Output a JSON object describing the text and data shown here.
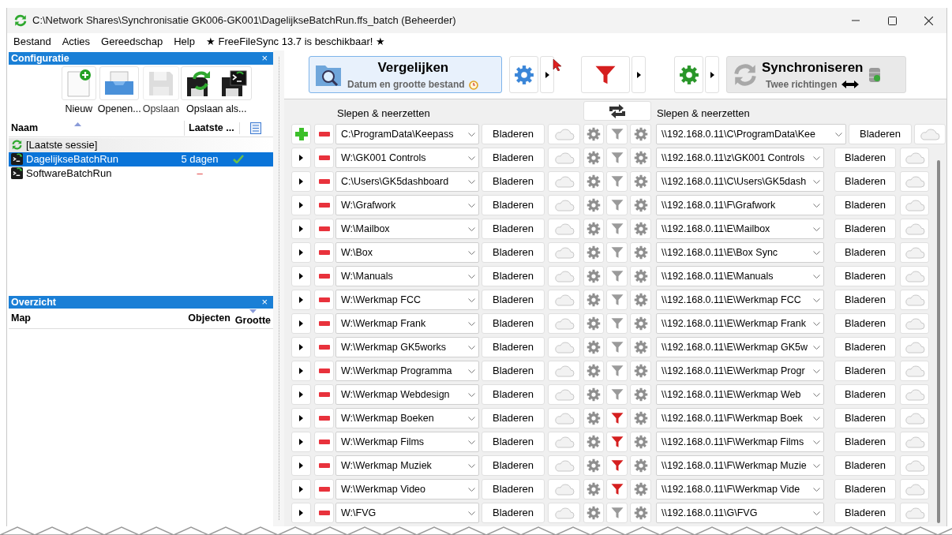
{
  "window": {
    "title": "C:\\Network Shares\\Synchronisatie GK006-GK001\\DagelijkseBatchRun.ffs_batch (Beheerder)"
  },
  "menu": [
    "Bestand",
    "Acties",
    "Gereedschap",
    "Help"
  ],
  "update_notice": "★ FreeFileSync 13.7 is beschikbaar! ★",
  "config_panel": {
    "title": "Configuratie",
    "close": "×",
    "tools": [
      {
        "kind": "new",
        "label": "Nieuw",
        "disabled": false
      },
      {
        "kind": "open",
        "label": "Openen...",
        "disabled": false
      },
      {
        "kind": "save",
        "label": "Opslaan",
        "disabled": true
      },
      {
        "kind": "save_as",
        "label": "Opslaan als...",
        "disabled": false
      }
    ],
    "columns": [
      "Naam",
      "Laatste ..."
    ],
    "items": [
      {
        "kind": "session",
        "name": "[Laatste sessie]",
        "selected": false
      },
      {
        "kind": "batch",
        "name": "DagelijkseBatchRun",
        "last_sync": "5 dagen",
        "ok": true,
        "selected": true
      },
      {
        "kind": "batch",
        "name": "SoftwareBatchRun",
        "last_sync": "–",
        "ok": false,
        "selected": false
      }
    ]
  },
  "overview_panel": {
    "title": "Overzicht",
    "close": "×",
    "columns": [
      "Map",
      "Objecten",
      "Grootte"
    ]
  },
  "compare_button": {
    "title": "Vergelijken",
    "subtitle": "Datum en grootte bestand"
  },
  "sync_button": {
    "title": "Synchroniseren",
    "subtitle": "Twee richtingen"
  },
  "folder_header": {
    "left": "Slepen & neerzetten",
    "right": "Slepen & neerzetten"
  },
  "folder_pairs": [
    {
      "kind": "base",
      "left": "C:\\ProgramData\\Keepass",
      "right": "\\\\192.168.0.11\\C\\ProgramData\\Kee",
      "browse_left": "Bladeren",
      "browse_right": "Bladeren",
      "filter_active": false
    },
    {
      "kind": "pair",
      "expanded": false,
      "left": "W:\\GK001 Controls",
      "right": "\\\\192.168.0.11\\z\\GK001 Controls",
      "browse_left": "Bladeren",
      "browse_right": "Bladeren",
      "filter_active": false
    },
    {
      "kind": "pair",
      "expanded": false,
      "left": "C:\\Users\\GK5dashboard",
      "right": "\\\\192.168.0.11\\C\\Users\\GK5dash",
      "browse_left": "Bladeren",
      "browse_right": "Bladeren",
      "filter_active": false
    },
    {
      "kind": "pair",
      "expanded": false,
      "left": "W:\\Grafwork",
      "right": "\\\\192.168.0.11\\F\\Grafwork",
      "browse_left": "Bladeren",
      "browse_right": "Bladeren",
      "filter_active": false
    },
    {
      "kind": "pair",
      "expanded": false,
      "left": "W:\\Mailbox",
      "right": "\\\\192.168.0.11\\E\\Mailbox",
      "browse_left": "Bladeren",
      "browse_right": "Bladeren",
      "filter_active": false
    },
    {
      "kind": "pair",
      "expanded": false,
      "left": "W:\\Box",
      "right": "\\\\192.168.0.11\\E\\Box Sync",
      "browse_left": "Bladeren",
      "browse_right": "Bladeren",
      "filter_active": false
    },
    {
      "kind": "pair",
      "expanded": false,
      "left": "W:\\Manuals",
      "right": "\\\\192.168.0.11\\E\\Manuals",
      "browse_left": "Bladeren",
      "browse_right": "Bladeren",
      "filter_active": false
    },
    {
      "kind": "pair",
      "expanded": false,
      "left": "W:\\Werkmap FCC",
      "right": "\\\\192.168.0.11\\E\\Werkmap FCC",
      "browse_left": "Bladeren",
      "browse_right": "Bladeren",
      "filter_active": false
    },
    {
      "kind": "pair",
      "expanded": false,
      "left": "W:\\Werkmap Frank",
      "right": "\\\\192.168.0.11\\E\\Werkmap Frank",
      "browse_left": "Bladeren",
      "browse_right": "Bladeren",
      "filter_active": false
    },
    {
      "kind": "pair",
      "expanded": false,
      "left": "W:\\Werkmap GK5works",
      "right": "\\\\192.168.0.11\\E\\Werkmap GK5w",
      "browse_left": "Bladeren",
      "browse_right": "Bladeren",
      "filter_active": false
    },
    {
      "kind": "pair",
      "expanded": false,
      "left": "W:\\Werkmap Programma",
      "right": "\\\\192.168.0.11\\E\\Werkmap Progr",
      "browse_left": "Bladeren",
      "browse_right": "Bladeren",
      "filter_active": false
    },
    {
      "kind": "pair",
      "expanded": false,
      "left": "W:\\Werkmap Webdesign",
      "right": "\\\\192.168.0.11\\E\\Werkmap Web",
      "browse_left": "Bladeren",
      "browse_right": "Bladeren",
      "filter_active": false
    },
    {
      "kind": "pair",
      "expanded": false,
      "left": "W:\\Werkmap Boeken",
      "right": "\\\\192.168.0.11\\F\\Werkmap Boek",
      "browse_left": "Bladeren",
      "browse_right": "Bladeren",
      "filter_active": true
    },
    {
      "kind": "pair",
      "expanded": false,
      "left": "W:\\Werkmap Films",
      "right": "\\\\192.168.0.11\\F\\Werkmap Films",
      "browse_left": "Bladeren",
      "browse_right": "Bladeren",
      "filter_active": true
    },
    {
      "kind": "pair",
      "expanded": false,
      "left": "W:\\Werkmap Muziek",
      "right": "\\\\192.168.0.11\\F\\Werkmap Muzie",
      "browse_left": "Bladeren",
      "browse_right": "Bladeren",
      "filter_active": true
    },
    {
      "kind": "pair",
      "expanded": false,
      "left": "W:\\Werkmap Video",
      "right": "\\\\192.168.0.11\\F\\Werkmap Vide",
      "browse_left": "Bladeren",
      "browse_right": "Bladeren",
      "filter_active": true
    },
    {
      "kind": "pair",
      "expanded": false,
      "left": "W:\\FVG",
      "right": "\\\\192.168.0.11\\G\\FVG",
      "browse_left": "Bladeren",
      "browse_right": "Bladeren",
      "filter_active": false
    }
  ]
}
